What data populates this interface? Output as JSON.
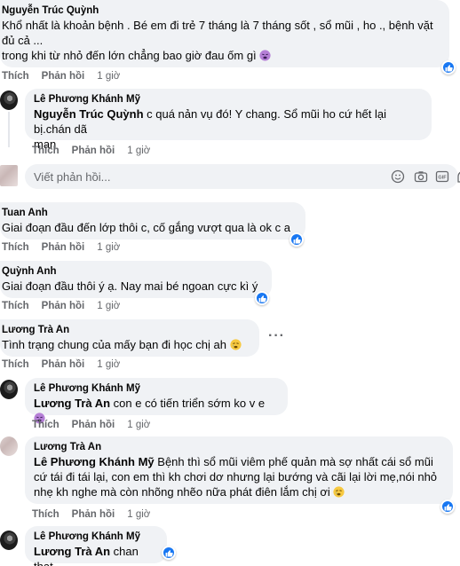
{
  "actions": {
    "like": "Thích",
    "reply": "Phản hồi"
  },
  "reply_box": {
    "placeholder": "Viết phản hồi..."
  },
  "comments": [
    {
      "author": "Nguyễn Trúc Quỳnh",
      "text_line1": "Khổ nhất là khoản bệnh . Bé em đi trẻ 7 tháng là 7 tháng sốt , sổ mũi , ho ., bệnh vặt",
      "text_line2": "đủ cả ...",
      "text_line3": "trong khi từ nhỏ đến lớn chẳng bao giờ đau ốm gì",
      "time": "1 giờ",
      "emoji": "weary-face-icon"
    },
    {
      "author": "Lê Phương Khánh Mỹ",
      "mention": "Nguyễn Trúc Quỳnh",
      "text_line1": " c quá nản vụ đó! Y chang. Sổ mũi ho cứ hết lại bị.chán dã",
      "text_line2": "man",
      "time": "1 giờ"
    },
    {
      "author": "Tuan Anh",
      "text": "Giai đoạn đầu đến lớp thôi c, cố gắng vượt qua là ok c a",
      "time": "1 giờ"
    },
    {
      "author": "Quỳnh Anh",
      "text": "Giai đoạn đầu thôi ý ạ. Nay mai bé ngoan cực kì ý",
      "time": "1 giờ"
    },
    {
      "author": "Lương Trà An",
      "text": "Tình trạng chung của mấy bạn đi học chị ah",
      "time": "1 giờ",
      "emoji": "crying-face-icon"
    },
    {
      "author": "Lê Phương Khánh Mỹ",
      "mention": "Lương Trà An",
      "text": " con e có tiến triển sớm ko v e",
      "time": "1 giờ",
      "emoji": "weary-face-icon"
    },
    {
      "author": "Lương Trà An",
      "mention": "Lê Phương Khánh Mỹ",
      "text_line1": " Bệnh thì sổ mũi viêm phế quản mà sợ nhất cái sổ mũi",
      "text_line2": "cứ tái đi tái lại, con em thì kh chơi dơ nhưng lại bướng và cãi lại lời mẹ,nói nhỏ",
      "text_line3": "nhẹ kh nghe mà còn nhõng nhẽo nữa phát điên lắm chị ơi",
      "time": "1 giờ",
      "emoji": "crying-face-icon"
    },
    {
      "author": "Lê Phương Khánh Mỹ",
      "mention": "Lương Trà An",
      "text": " chan that"
    }
  ],
  "colors": {
    "like_blue": "#1877f2",
    "bubble_bg": "#f0f2f5",
    "meta_gray": "#65676b"
  }
}
